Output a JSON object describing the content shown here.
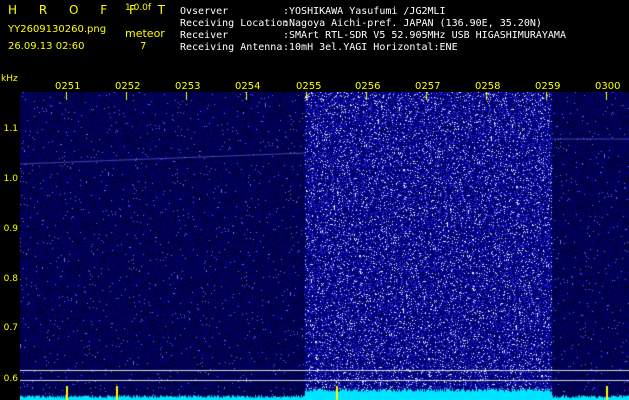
{
  "app": {
    "logo": "H R O F F T",
    "version": "1.0.0f",
    "filename": "YY2609130260.png",
    "datetime": "26.09.13 02:60",
    "meteor_label": "meteor",
    "meteor_count": "7"
  },
  "info": [
    {
      "key": "Ovserver",
      "value": ":YOSHIKAWA Yasufumi /JG2MLI"
    },
    {
      "key": "Receiving Location",
      "value": ":Nagoya Aichi-pref. JAPAN (136.90E, 35.20N)"
    },
    {
      "key": "Receiver",
      "value": ":SMArt RTL-SDR V5 52.905MHz USB HIGASHIMURAYAMA"
    },
    {
      "key": "Receiving Antenna",
      "value": ":10mH 3el.YAGI Horizontal:ENE"
    }
  ],
  "axis": {
    "unit": "kHz",
    "y_ticks": [
      "1.1",
      "1.0",
      "0.9",
      "0.8",
      "0.7",
      "0.6"
    ],
    "x_ticks": [
      "0251",
      "0252",
      "0253",
      "0254",
      "0255",
      "0256",
      "0257",
      "0258",
      "0259",
      "0300"
    ]
  },
  "colors": {
    "text": "#ffff00",
    "info_text": "#ffffff",
    "background": "#000000",
    "noise_dim": "#0a0a80",
    "noise_bright": "#2a2aff",
    "baseline": "#00e5ff"
  }
}
